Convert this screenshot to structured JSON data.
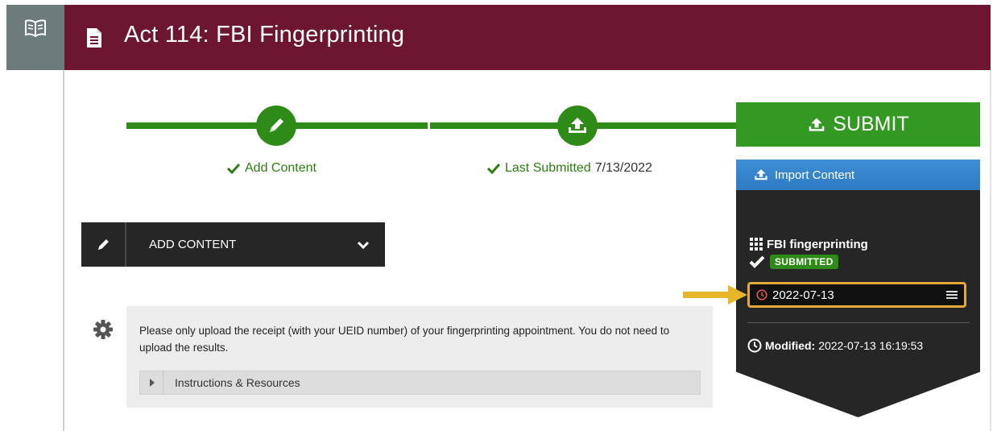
{
  "header": {
    "title": "Act 114: FBI Fingerprinting",
    "side_icon": "book-icon",
    "doc_icon": "document-icon",
    "color": "#6d1632"
  },
  "progress": {
    "steps": [
      {
        "label": "Add Content",
        "icon": "pencil-icon",
        "status": "complete"
      },
      {
        "label": "Last Submitted",
        "date": "7/13/2022",
        "icon": "upload-icon",
        "status": "complete"
      }
    ],
    "color": "#2e8b17"
  },
  "submit": {
    "label": "SUBMIT"
  },
  "import": {
    "label": "Import Content"
  },
  "submission": {
    "file_name": "FBI fingerprinting",
    "status": "SUBMITTED",
    "date": "2022-07-13",
    "modified_label": "Modified:",
    "modified_value": "2022-07-13 16:19:53"
  },
  "add_content": {
    "label": "ADD CONTENT"
  },
  "instructions": {
    "text": "Please only upload the receipt (with your UEID number) of your fingerprinting appointment. You do not need to upload the results.",
    "section_label": "Instructions & Resources"
  },
  "colors": {
    "accent": "#339922",
    "header": "#6d1632",
    "highlight": "#e2a93a",
    "import": "#3584cc"
  }
}
